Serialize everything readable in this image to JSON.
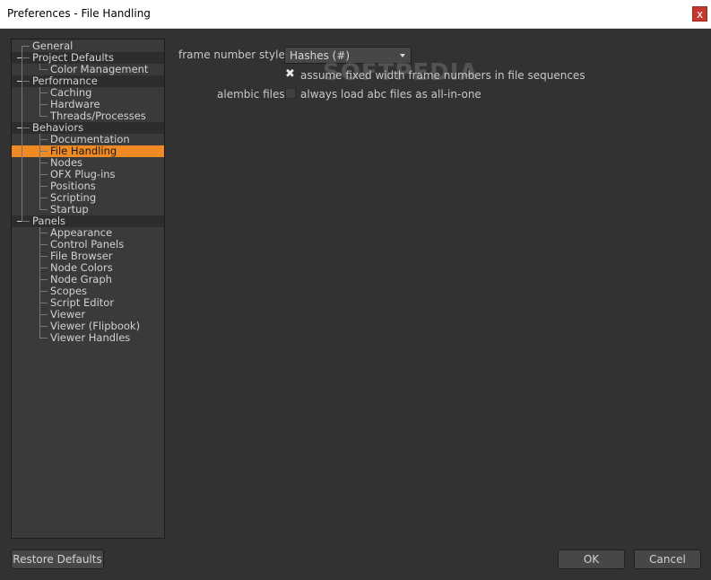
{
  "window": {
    "title": "Preferences - File Handling",
    "close_label": "x"
  },
  "tree": {
    "items": [
      {
        "label": "General",
        "level": 0,
        "category": false
      },
      {
        "label": "Project Defaults",
        "level": 0,
        "category": true
      },
      {
        "label": "Color Management",
        "level": 1,
        "category": false
      },
      {
        "label": "Performance",
        "level": 0,
        "category": true
      },
      {
        "label": "Caching",
        "level": 1,
        "category": false
      },
      {
        "label": "Hardware",
        "level": 1,
        "category": false
      },
      {
        "label": "Threads/Processes",
        "level": 1,
        "category": false
      },
      {
        "label": "Behaviors",
        "level": 0,
        "category": true
      },
      {
        "label": "Documentation",
        "level": 1,
        "category": false
      },
      {
        "label": "File Handling",
        "level": 1,
        "category": false,
        "selected": true
      },
      {
        "label": "Nodes",
        "level": 1,
        "category": false
      },
      {
        "label": "OFX Plug-ins",
        "level": 1,
        "category": false
      },
      {
        "label": "Positions",
        "level": 1,
        "category": false
      },
      {
        "label": "Scripting",
        "level": 1,
        "category": false
      },
      {
        "label": "Startup",
        "level": 1,
        "category": false
      },
      {
        "label": "Panels",
        "level": 0,
        "category": true
      },
      {
        "label": "Appearance",
        "level": 1,
        "category": false
      },
      {
        "label": "Control Panels",
        "level": 1,
        "category": false
      },
      {
        "label": "File Browser",
        "level": 1,
        "category": false
      },
      {
        "label": "Node Colors",
        "level": 1,
        "category": false
      },
      {
        "label": "Node Graph",
        "level": 1,
        "category": false
      },
      {
        "label": "Scopes",
        "level": 1,
        "category": false
      },
      {
        "label": "Script Editor",
        "level": 1,
        "category": false
      },
      {
        "label": "Viewer",
        "level": 1,
        "category": false
      },
      {
        "label": "Viewer (Flipbook)",
        "level": 1,
        "category": false
      },
      {
        "label": "Viewer Handles",
        "level": 1,
        "category": false
      }
    ]
  },
  "form": {
    "frame_number_style_label": "frame number style",
    "frame_number_style_value": "Hashes (#)",
    "fixed_width_label": "assume fixed width frame numbers in file sequences",
    "fixed_width_checked": true,
    "alembic_label": "alembic files",
    "alembic_option_label": "always load abc files as all-in-one",
    "alembic_checked": false
  },
  "watermark": "SOFTPEDIA",
  "buttons": {
    "restore": "Restore Defaults",
    "ok": "OK",
    "cancel": "Cancel"
  },
  "colors": {
    "accent": "#f08a24",
    "background": "#323232",
    "close": "#c4372c"
  }
}
